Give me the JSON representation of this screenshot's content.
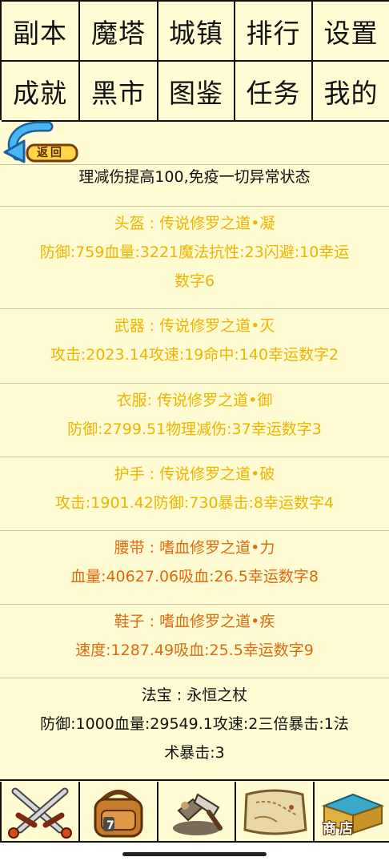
{
  "nav": {
    "row1": [
      "副本",
      "魔塔",
      "城镇",
      "排行",
      "设置"
    ],
    "row2": [
      "成就",
      "黑市",
      "图鉴",
      "任务",
      "我的"
    ]
  },
  "back": {
    "label": "返回"
  },
  "intro": "理减伤提高100,免疫一切异常状态",
  "equipment": [
    {
      "title": "头盔 : 传说修罗之道•凝",
      "lines": [
        "防御:759血量:3221魔法抗性:23闪避:10幸运",
        "数字6"
      ]
    },
    {
      "title": "武器 : 传说修罗之道•灭",
      "lines": [
        "攻击:2023.14攻速:19命中:140幸运数字2"
      ]
    },
    {
      "title": "衣服: 传说修罗之道•御",
      "lines": [
        "防御:2799.51物理减伤:37幸运数字3"
      ]
    },
    {
      "title": "护手 : 传说修罗之道•破",
      "lines": [
        "攻击:1901.42防御:730暴击:8幸运数字4"
      ]
    },
    {
      "title": "腰带 : 嗜血修罗之道•力",
      "lines": [
        "血量:40627.06吸血:26.5幸运数字8"
      ]
    },
    {
      "title": "鞋子 : 嗜血修罗之道•疾",
      "lines": [
        "速度:1287.49吸血:25.5幸运数字9"
      ]
    },
    {
      "title": "法宝 : 永恒之杖",
      "lines": [
        "防御:1000血量:29549.1攻速:2三倍暴击:1法",
        "术暴击:3"
      ]
    }
  ],
  "toolbar": {
    "shop_label": "商店",
    "icons": [
      "crossed-swords-icon",
      "backpack-icon",
      "forge-icon",
      "scroll-map-icon",
      "shop-chest-icon"
    ]
  },
  "colors": {
    "background": "#fffbd2",
    "legendary": "#f0b400",
    "bloody": "#e06a10",
    "text": "#111111"
  }
}
